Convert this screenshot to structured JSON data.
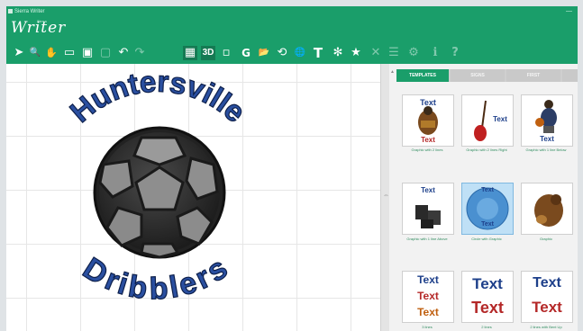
{
  "window": {
    "title": "Sierra Writer",
    "minimize_symbol": "—",
    "accent": "#1a9e6a"
  },
  "header": {
    "logo_text": "Writer",
    "logo_sub": "Sierra"
  },
  "toolbar": {
    "items": [
      {
        "icon": "select-arrow-icon",
        "glyph": "➤"
      },
      {
        "icon": "zoom-icon",
        "glyph": "🔍"
      },
      {
        "icon": "pan-hand-icon",
        "glyph": "✋"
      },
      {
        "icon": "monitor-icon",
        "glyph": "▭"
      },
      {
        "icon": "monitor-alt-icon",
        "glyph": "▣"
      },
      {
        "icon": "hoop-icon",
        "glyph": "▢"
      },
      {
        "icon": "undo-icon",
        "glyph": "↶"
      },
      {
        "icon": "redo-icon",
        "glyph": "↷"
      },
      {
        "icon": "grid-icon",
        "glyph": "▦"
      },
      {
        "icon": "3d-view-icon",
        "glyph": "3D"
      },
      {
        "icon": "frame-icon",
        "glyph": "▫"
      },
      {
        "icon": "g-icon",
        "glyph": "G"
      },
      {
        "icon": "folder-icon",
        "glyph": "📂"
      },
      {
        "icon": "refresh-icon",
        "glyph": "⟲"
      },
      {
        "icon": "globe-icon",
        "glyph": "🌐"
      },
      {
        "icon": "text-icon",
        "glyph": "T"
      },
      {
        "icon": "network-icon",
        "glyph": "✻"
      },
      {
        "icon": "star-icon",
        "glyph": "★"
      },
      {
        "icon": "close-icon",
        "glyph": "✕"
      },
      {
        "icon": "list-icon",
        "glyph": "☰"
      },
      {
        "icon": "settings-icon",
        "glyph": "⚙"
      },
      {
        "icon": "info-icon",
        "glyph": "ℹ"
      },
      {
        "icon": "help-icon",
        "glyph": "?"
      }
    ]
  },
  "design": {
    "top_text": "Huntersville",
    "bottom_text": "Dribblers",
    "text_color": "#2a4fa0"
  },
  "panel": {
    "tabs": [
      {
        "label": "TEMPLATES",
        "active": true
      },
      {
        "label": "SIGNS",
        "active": false
      },
      {
        "label": "FIRST",
        "active": false
      },
      {
        "label": "",
        "active": false
      }
    ],
    "templates": [
      {
        "caption": "Graphic with 2 lines",
        "line1": "Text",
        "line2": "Text"
      },
      {
        "caption": "Graphic with 2 lines Right",
        "line1": "Text",
        "line2": ""
      },
      {
        "caption": "Graphic with 1 line Below",
        "line1": "Text",
        "line2": ""
      },
      {
        "caption": "Graphic with 1 line Above",
        "line1": "Text",
        "line2": ""
      },
      {
        "caption": "Circle with Graphic",
        "line1": "Text",
        "line2": "Text"
      },
      {
        "caption": "Graphic",
        "line1": "",
        "line2": ""
      },
      {
        "caption": "3 lines",
        "line1": "Text",
        "line2": "Text",
        "line3": "Text"
      },
      {
        "caption": "2 lines",
        "line1": "Text",
        "line2": "Text"
      },
      {
        "caption": "2 lines with Bent Up",
        "line1": "Text",
        "line2": "Text"
      }
    ]
  }
}
